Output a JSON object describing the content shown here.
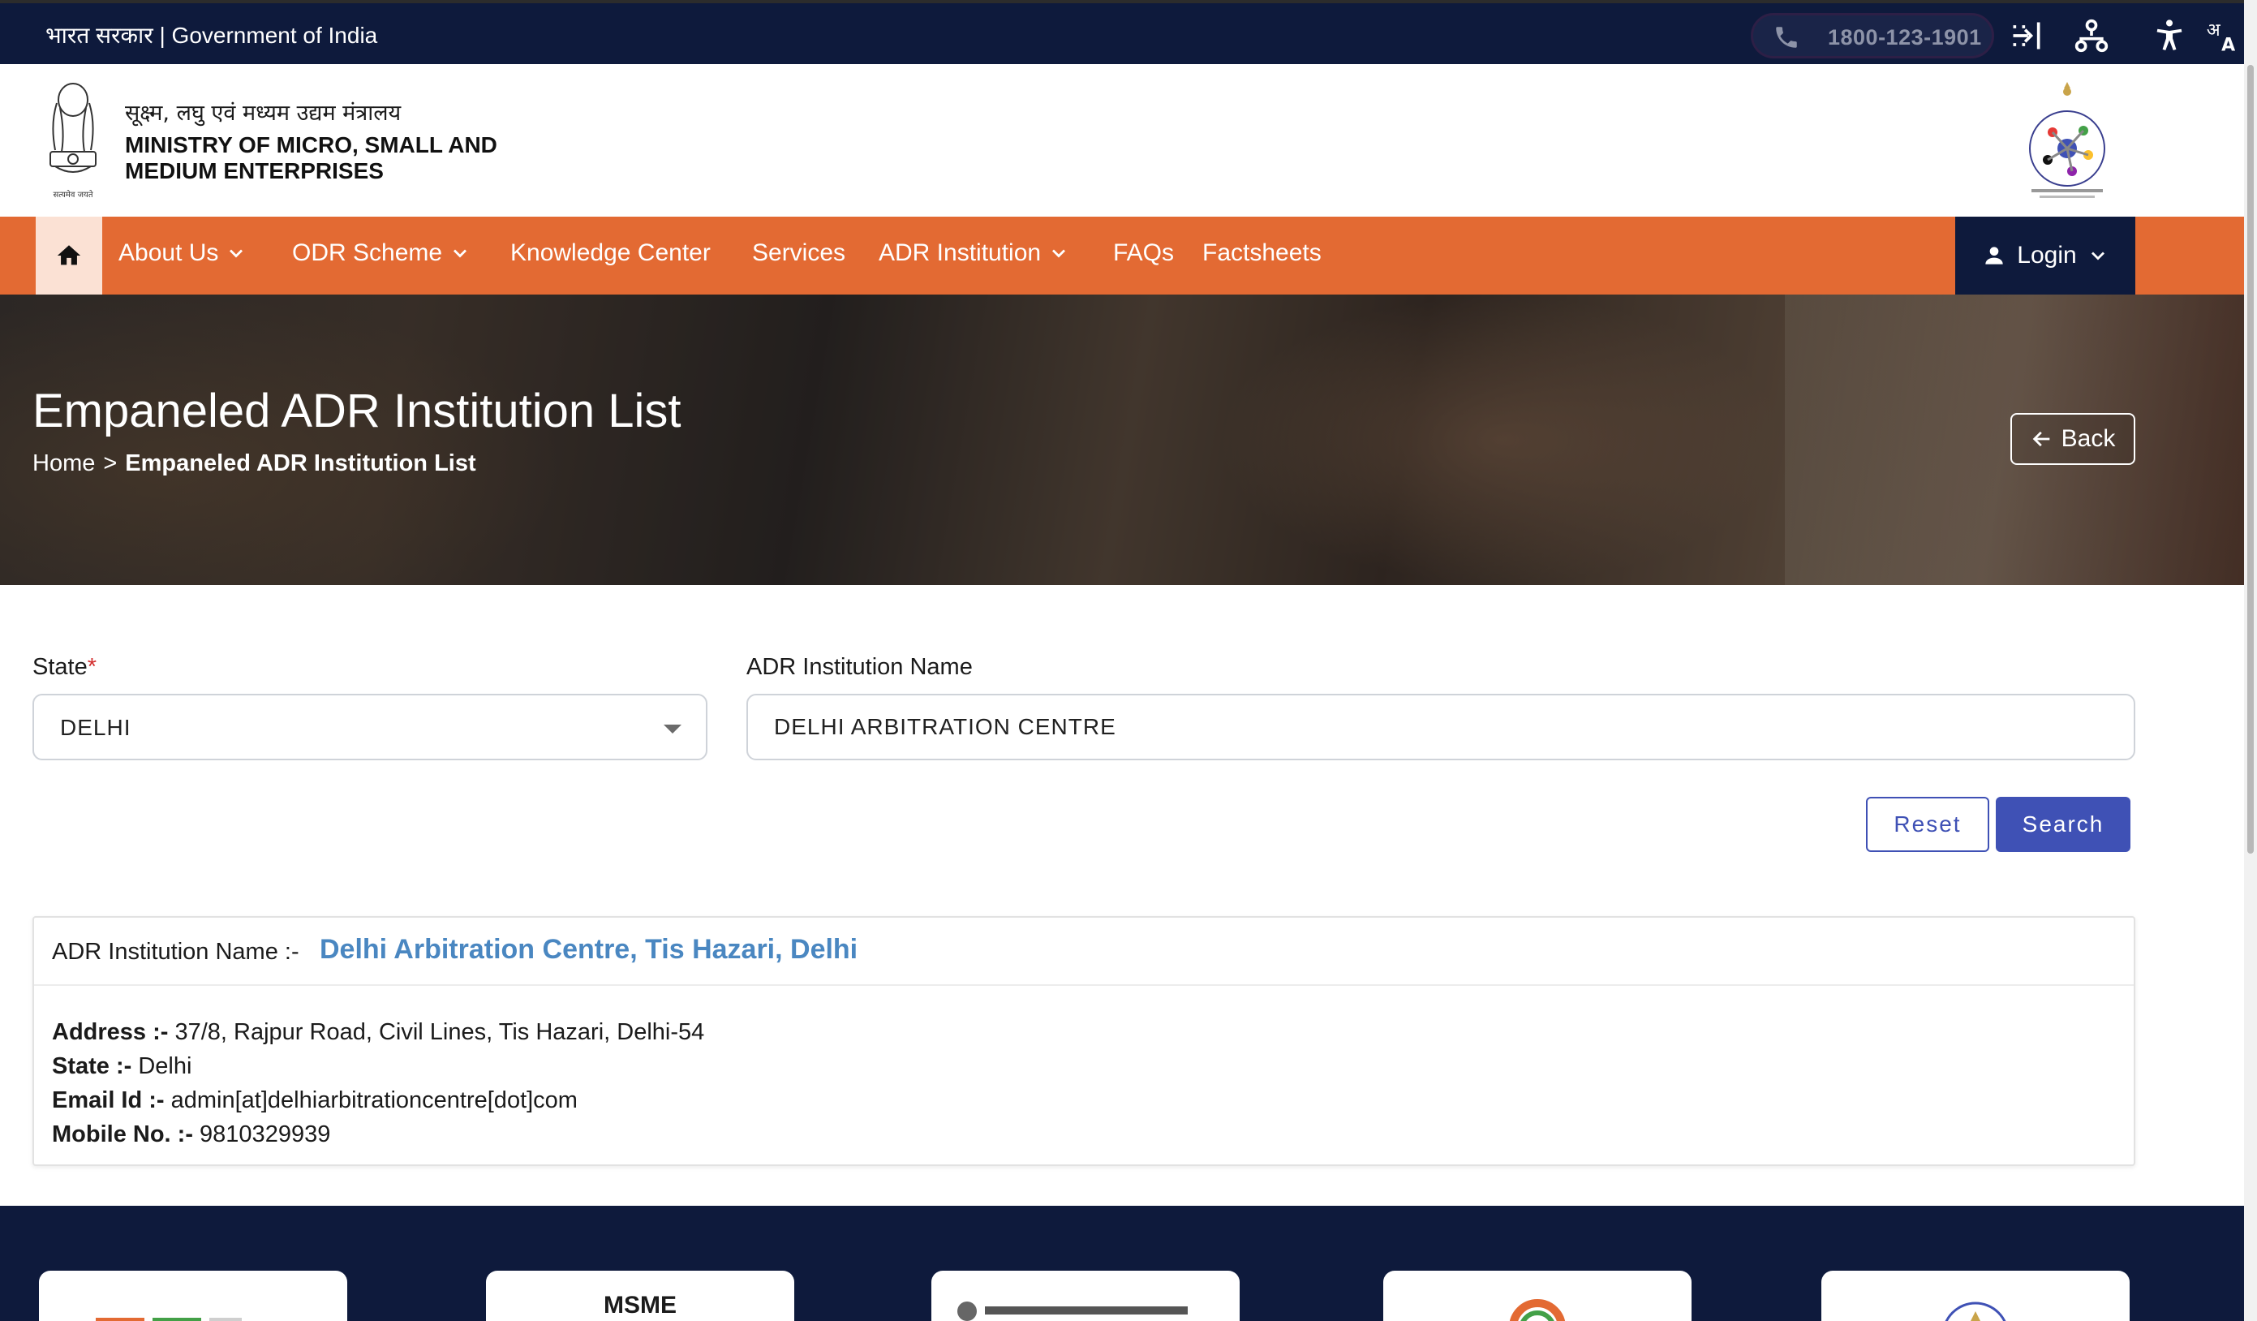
{
  "gov_bar": {
    "text": "भारत सरकार | Government of India",
    "phone": "1800-123-1901"
  },
  "header": {
    "ministry_hindi": "सूक्ष्म, लघु एवं मध्यम उद्यम मंत्रालय",
    "ministry_english": "MINISTRY OF MICRO, SMALL AND MEDIUM ENTERPRISES"
  },
  "nav": {
    "items": [
      {
        "label": "About Us"
      },
      {
        "label": "ODR Scheme"
      },
      {
        "label": "Knowledge Center"
      },
      {
        "label": "Services"
      },
      {
        "label": "ADR Institution"
      },
      {
        "label": "FAQs"
      },
      {
        "label": "Factsheets"
      }
    ],
    "login_label": "Login"
  },
  "hero": {
    "title": "Empaneled ADR Institution List",
    "breadcrumb_home": "Home",
    "breadcrumb_sep": ">",
    "breadcrumb_current": "Empaneled ADR Institution List",
    "back_label": "Back"
  },
  "form": {
    "state_label": "State",
    "state_required": "*",
    "state_value": "DELHI",
    "institution_label": "ADR Institution Name",
    "institution_value": "DELHI ARBITRATION CENTRE",
    "reset_label": "Reset",
    "search_label": "Search"
  },
  "result": {
    "name_label": "ADR Institution Name :-",
    "name": "Delhi Arbitration Centre, Tis Hazari, Delhi",
    "address_label": "Address :-",
    "address": "37/8, Rajpur Road, Civil Lines, Tis Hazari, Delhi-54",
    "state_label": "State :-",
    "state": "Delhi",
    "email_label": "Email Id :-",
    "email": "admin[at]delhiarbitrationcentre[dot]com",
    "mobile_label": "Mobile No. :-",
    "mobile": "9810329939"
  },
  "footer": {
    "msme_label": "MSME"
  },
  "colors": {
    "navy": "#0e1a3c",
    "orange": "#e36a33",
    "primary": "#3f51b5",
    "link_blue": "#4a87c1"
  }
}
